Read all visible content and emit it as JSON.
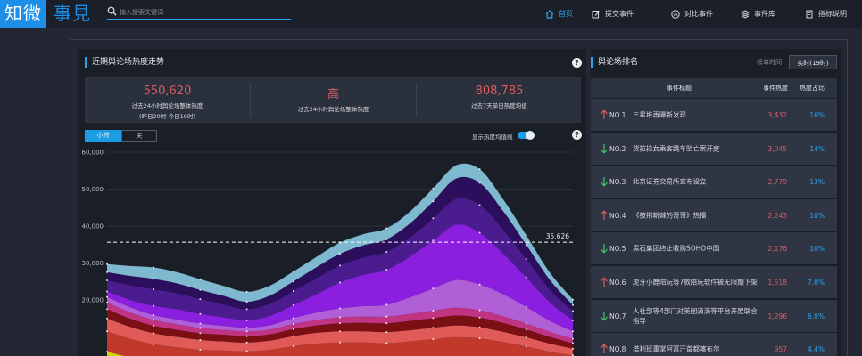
{
  "app": {
    "logo_main": "知微",
    "logo_side": "事見"
  },
  "search": {
    "placeholder": "输入搜索关键词"
  },
  "nav": [
    {
      "label": "首页",
      "icon": "home-icon",
      "active": true
    },
    {
      "label": "提交事件",
      "icon": "edit-icon",
      "active": false
    },
    {
      "label": "对比事件",
      "icon": "compare-icon",
      "active": false
    },
    {
      "label": "事件库",
      "icon": "stack-icon",
      "active": false
    },
    {
      "label": "指标说明",
      "icon": "document-icon",
      "active": false
    }
  ],
  "trend": {
    "title": "近期舆论场热度走势",
    "stats": [
      {
        "value": "550,620",
        "label": "过去24小时舆论场整体热度",
        "sub": "(昨日20时-今日19时)"
      },
      {
        "value": "高",
        "label": "过去24小时舆论场整体热度",
        "sub": ""
      },
      {
        "value": "808,785",
        "label": "过去7天单日热度均值",
        "sub": ""
      }
    ],
    "tabs": [
      "小时",
      "天"
    ],
    "active_tab": "小时",
    "toggle_label": "显示热度均值线",
    "toggle_on": true
  },
  "chart_data": {
    "type": "area",
    "y_ticks": [
      "60,000",
      "50,000",
      "40,000",
      "30,000",
      "20,000"
    ],
    "ylim": [
      0,
      60000
    ],
    "average_line": {
      "value": 35626,
      "label": "35,626"
    },
    "x": [
      0,
      1,
      2,
      3,
      4,
      5,
      6,
      7,
      8,
      9,
      10,
      11,
      12,
      13,
      14,
      15,
      16,
      17,
      18,
      19,
      20
    ],
    "series": [
      {
        "color": "#d9d200",
        "values": [
          6000,
          4500,
          3500,
          3000,
          2500,
          2300,
          2300,
          2500,
          3000,
          3200,
          3500,
          3700,
          3800,
          4000,
          4200,
          4400,
          4300,
          3800,
          3200,
          2500,
          2000
        ]
      },
      {
        "color": "#c0392b",
        "values": [
          5500,
          5000,
          4500,
          4200,
          4000,
          4000,
          3800,
          4000,
          4500,
          5000,
          5000,
          4800,
          4500,
          4800,
          5200,
          5500,
          5300,
          4800,
          4200,
          3500,
          3000
        ]
      },
      {
        "color": "#e05a58",
        "values": [
          3500,
          3200,
          3000,
          2800,
          2700,
          2500,
          2400,
          2500,
          2700,
          2900,
          3000,
          3000,
          3000,
          3000,
          3100,
          3200,
          3000,
          2800,
          2500,
          2200,
          1800
        ]
      },
      {
        "color": "#7a0f14",
        "values": [
          2500,
          2200,
          2000,
          1900,
          1800,
          1800,
          1700,
          1700,
          1900,
          2000,
          2200,
          2300,
          2400,
          2500,
          2600,
          2700,
          2600,
          2400,
          2100,
          1800,
          1500
        ]
      },
      {
        "color": "#c13383",
        "values": [
          1800,
          1700,
          1600,
          1500,
          1400,
          1300,
          1300,
          1300,
          1400,
          1500,
          1600,
          1700,
          1800,
          1900,
          2000,
          2100,
          2000,
          1800,
          1600,
          1400,
          1200
        ]
      },
      {
        "color": "#b05fd6",
        "values": [
          1500,
          1400,
          1300,
          1300,
          1200,
          1100,
          1000,
          1200,
          1600,
          2000,
          2400,
          2800,
          3200,
          4500,
          6000,
          7500,
          7000,
          6000,
          4500,
          3000,
          2000
        ]
      },
      {
        "color": "#8a1fe0",
        "values": [
          1500,
          2000,
          2500,
          2800,
          2600,
          2300,
          2000,
          2500,
          3500,
          5000,
          7000,
          8500,
          9500,
          11000,
          13000,
          15000,
          14000,
          11000,
          8000,
          5000,
          3000
        ]
      },
      {
        "color": "#4a1c8e",
        "values": [
          3000,
          4000,
          4500,
          4300,
          4000,
          3500,
          3000,
          3300,
          3800,
          4300,
          4600,
          4700,
          4800,
          5200,
          6000,
          7000,
          7500,
          6500,
          5000,
          3500,
          2500
        ]
      },
      {
        "color": "#2b0e5c",
        "values": [
          2200,
          2500,
          2800,
          2700,
          2500,
          2300,
          2000,
          2200,
          2600,
          3000,
          3200,
          3300,
          3400,
          3800,
          4600,
          5500,
          6000,
          5000,
          3800,
          2600,
          1600
        ]
      },
      {
        "color": "#7fb9cf",
        "values": [
          2200,
          2700,
          3100,
          3000,
          2900,
          2700,
          2700,
          2700,
          2700,
          2800,
          3000,
          3000,
          3000,
          3200,
          3500,
          3600,
          3700,
          3200,
          2600,
          2000,
          1500
        ]
      }
    ]
  },
  "ranking": {
    "title": "舆论场排名",
    "switch": [
      "榜单时间",
      "实时(19时)"
    ],
    "headers": [
      "事件标题",
      "事件热度",
      "热度占比"
    ],
    "rows": [
      {
        "rank": "NO.1",
        "trend": "up",
        "title": "三星堆再曝新发现",
        "heat": "3,432",
        "pct": "16%"
      },
      {
        "rank": "NO.2",
        "trend": "down",
        "title": "货拉拉女乘客跳车坠亡案开庭",
        "heat": "3,045",
        "pct": "14%"
      },
      {
        "rank": "NO.3",
        "trend": "down",
        "title": "北京证券交易所宣布设立",
        "heat": "2,779",
        "pct": "13%"
      },
      {
        "rank": "NO.4",
        "trend": "up",
        "title": "《披荆斩棘的哥哥》热播",
        "heat": "2,243",
        "pct": "10%"
      },
      {
        "rank": "NO.5",
        "trend": "down",
        "title": "黑石集团终止收购SOHO中国",
        "heat": "2,176",
        "pct": "10%"
      },
      {
        "rank": "NO.6",
        "trend": "up",
        "title": "虎牙小鹿陪玩等7款陪玩软件被无限期下架",
        "heat": "1,518",
        "pct": "7.0%"
      },
      {
        "rank": "NO.7",
        "trend": "down",
        "title": "人社部等4部门对美团滴滴等平台开展联合指导",
        "heat": "1,296",
        "pct": "6.0%"
      },
      {
        "rank": "NO.8",
        "trend": "up",
        "title": "塔利班重掌阿富汗首都喀布尔",
        "heat": "957",
        "pct": "4.4%"
      }
    ],
    "colors": {
      "up": "#e05b63",
      "down": "#3cc96b"
    }
  }
}
